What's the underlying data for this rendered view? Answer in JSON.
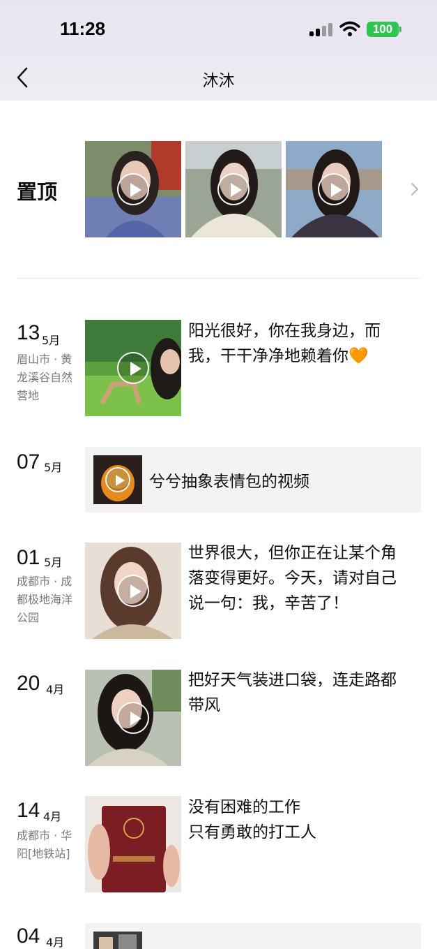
{
  "status_bar": {
    "time": "11:28",
    "battery": "100"
  },
  "nav": {
    "title": "沐沐"
  },
  "pinned": {
    "label": "置顶",
    "items": [
      "video-1",
      "video-2",
      "video-3"
    ]
  },
  "posts": [
    {
      "day": "13",
      "month": "5月",
      "location": "眉山市 · 黄龙溪谷自然营地",
      "text": "阳光很好，你在我身边，而我，干干净净地赖着你🧡"
    },
    {
      "day": "07",
      "month": "5月",
      "shared": {
        "text": "兮兮抽象表情包的视频"
      }
    },
    {
      "day": "01",
      "month": "5月",
      "location": "成都市 · 成都极地海洋公园",
      "text": "世界很大，但你正在让某个角落变得更好。今天，请对自己说一句：我，辛苦了！"
    },
    {
      "day": "20",
      "month": "4月",
      "text": "把好天气装进口袋，连走路都带风"
    },
    {
      "day": "14",
      "month": "4月",
      "location": "成都市 · 华阳[地铁站]",
      "text_lines": [
        "没有困难的工作",
        "只有勇敢的打工人"
      ]
    },
    {
      "day": "04",
      "month": "4月"
    }
  ],
  "icons": [
    "back-icon",
    "play-icon",
    "chevron-right-icon",
    "signal-icon",
    "wifi-icon",
    "battery-icon"
  ],
  "colors": {
    "header_bg": "#ECE8F2",
    "battery_green": "#30C552",
    "card_bg": "#F3F3F3",
    "location_gray": "#7A7A7A"
  }
}
